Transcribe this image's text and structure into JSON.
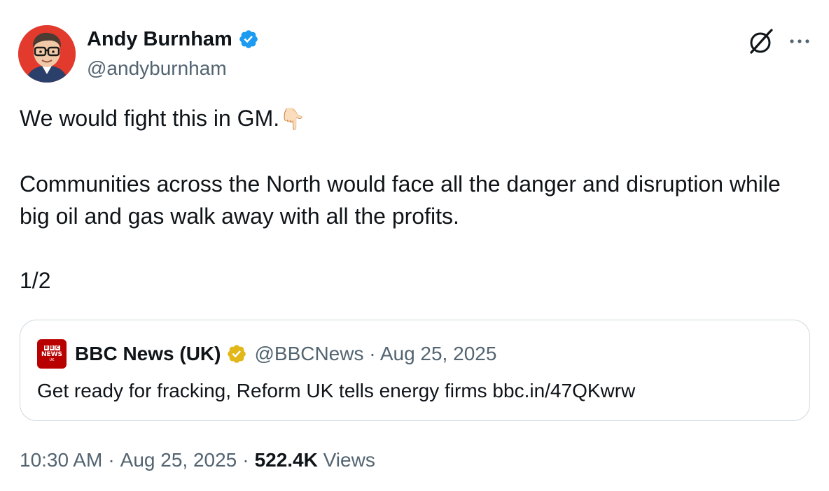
{
  "author": {
    "name": "Andy Burnham",
    "handle": "@andyburnham",
    "verified_color": "#1d9bf0"
  },
  "tweet": {
    "line1": "We would fight this in GM.",
    "line1_emoji": "👇🏻",
    "line2": "Communities across the North would face all the danger and disruption while big oil and gas walk away with all the profits.",
    "line3": "1/2"
  },
  "quote": {
    "logo": {
      "line1_blocks": [
        "B",
        "B",
        "C"
      ],
      "word": "NEWS",
      "sub": "UK"
    },
    "name": "BBC News (UK)",
    "badge_color": "#e2b719",
    "handle_date": "@BBCNews · Aug 25, 2025",
    "text": "Get ready for fracking, Reform UK tells energy firms bbc.in/47QKwrw"
  },
  "meta": {
    "time": "10:30 AM",
    "date": "Aug 25, 2025",
    "views_count": "522.4K",
    "views_label": "Views",
    "separator": "·"
  },
  "icons": {
    "grok": "grok-icon",
    "more": "more-horizontal-icon"
  },
  "colors": {
    "text": "#0f1419",
    "secondary": "#536471",
    "border": "#cfd9de",
    "avatar_bg": "#e23a2c"
  }
}
